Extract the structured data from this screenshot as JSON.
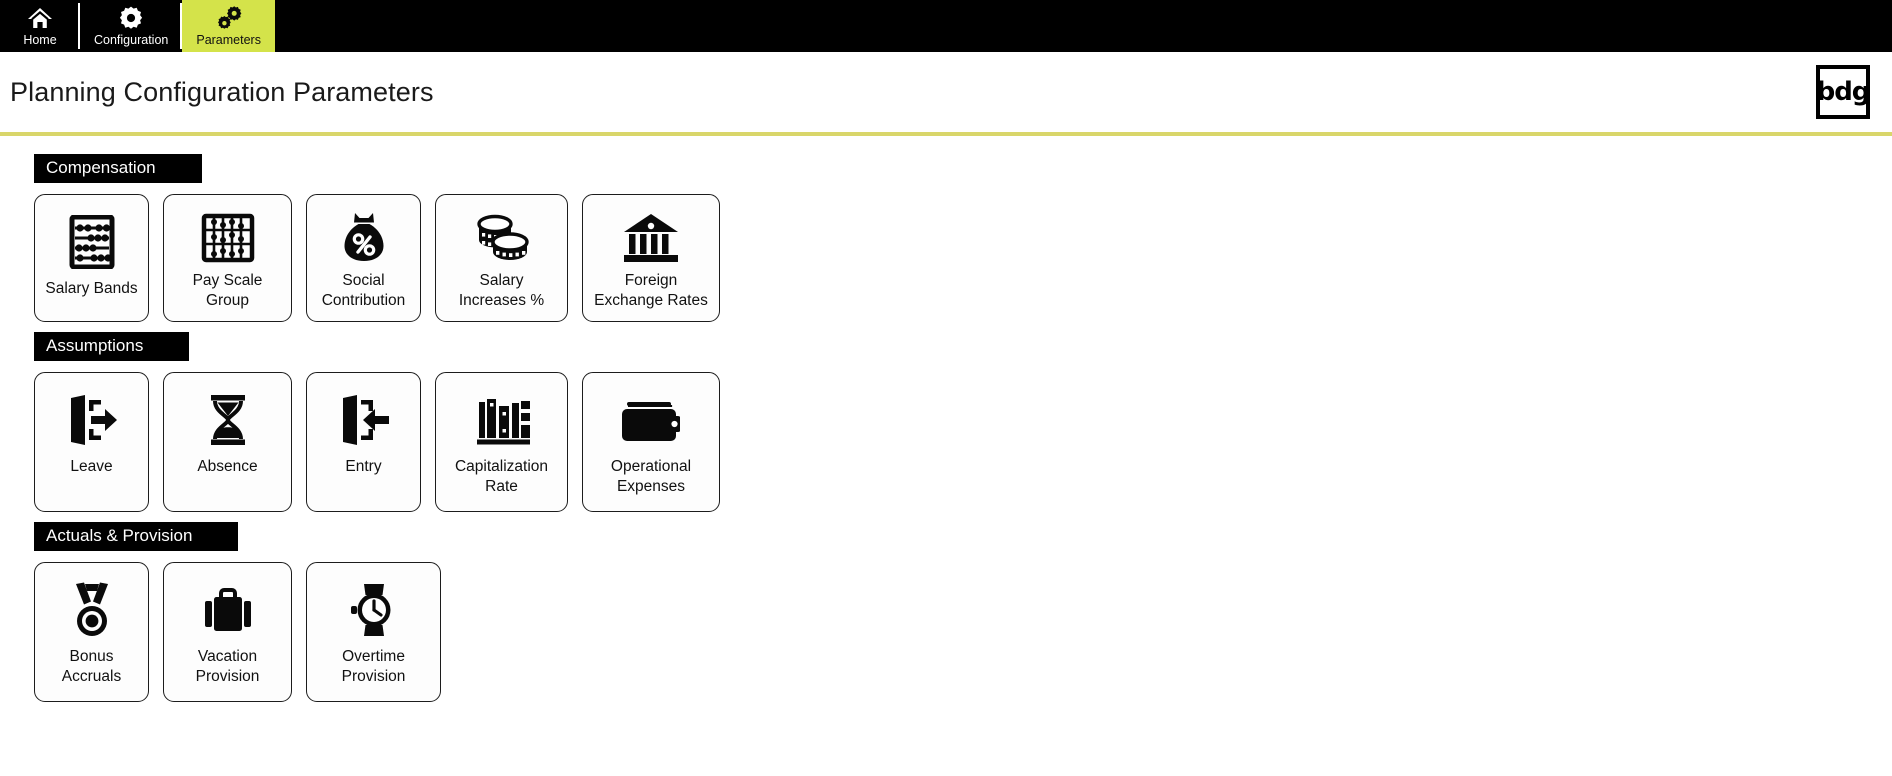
{
  "nav": {
    "items": [
      {
        "id": "home",
        "label": "Home",
        "icon": "home-icon",
        "active": false
      },
      {
        "id": "configuration",
        "label": "Configuration",
        "icon": "gear-icon",
        "active": false
      },
      {
        "id": "parameters",
        "label": "Parameters",
        "icon": "gears-icon",
        "active": true
      }
    ]
  },
  "header": {
    "title": "Planning Configuration Parameters",
    "logo_text": "bdg"
  },
  "colors": {
    "nav_background": "#000000",
    "active_tab": "#d4e34a",
    "header_rule": "#d9d66a",
    "section_bar": "#000000",
    "tile_border": "#1c1c1c",
    "page_background": "#ffffff"
  },
  "sections": [
    {
      "id": "compensation",
      "title": "Compensation",
      "tiles": [
        {
          "id": "salary-bands",
          "label": "Salary Bands",
          "icon": "abacus-vertical-icon"
        },
        {
          "id": "pay-scale-group",
          "label": "Pay Scale Group",
          "icon": "abacus-grid-icon"
        },
        {
          "id": "social-contribution",
          "label": "Social\nContribution",
          "icon": "money-bag-percent-icon"
        },
        {
          "id": "salary-increases",
          "label": "Salary\nIncreases %",
          "icon": "coins-stack-icon"
        },
        {
          "id": "foreign-exchange-rates",
          "label": "Foreign\nExchange Rates",
          "icon": "bank-icon"
        }
      ]
    },
    {
      "id": "assumptions",
      "title": "Assumptions",
      "tiles": [
        {
          "id": "leave",
          "label": "Leave",
          "icon": "door-exit-icon"
        },
        {
          "id": "absence",
          "label": "Absence",
          "icon": "hourglass-icon"
        },
        {
          "id": "entry",
          "label": "Entry",
          "icon": "door-enter-icon"
        },
        {
          "id": "capitalization-rate",
          "label": "Capitalization\nRate",
          "icon": "books-icon"
        },
        {
          "id": "operational-expenses",
          "label": "Operational\nExpenses",
          "icon": "wallet-icon"
        }
      ]
    },
    {
      "id": "actuals-provision",
      "title": "Actuals & Provision",
      "tiles": [
        {
          "id": "bonus-accruals",
          "label": "Bonus Accruals",
          "icon": "medal-icon"
        },
        {
          "id": "vacation-provision",
          "label": "Vacation\nProvision",
          "icon": "suitcase-icon"
        },
        {
          "id": "overtime-provision",
          "label": "Overtime\nProvision",
          "icon": "watch-icon"
        }
      ]
    }
  ]
}
